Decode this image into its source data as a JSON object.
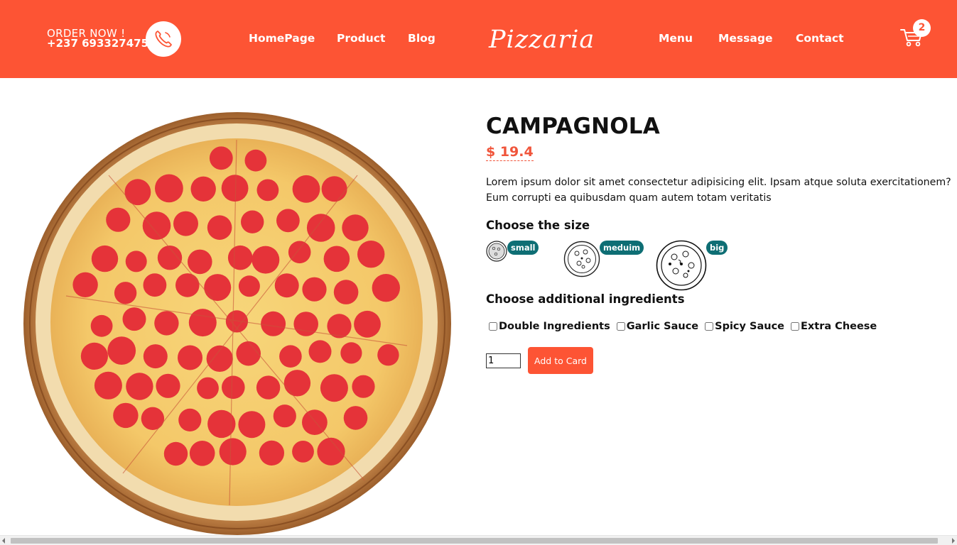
{
  "colors": {
    "accent": "#fd5434",
    "badge": "#0e6e74",
    "price": "#f0553b"
  },
  "header": {
    "order_label": "ORDER NOW !",
    "phone": "+237 693327475",
    "phone_icon": "phone-icon",
    "nav_left": [
      "HomePage",
      "Product",
      "Blog"
    ],
    "logo": "Pizzaria",
    "nav_right": [
      "Menu",
      "Message",
      "Contact"
    ],
    "cart_icon": "cart-icon",
    "cart_count": "2"
  },
  "product": {
    "title": "CAMPAGNOLA",
    "price": "$ 19.4",
    "description": "Lorem ipsum dolor sit amet consectetur adipisicing elit. Ipsam atque soluta exercitationem? Eum corrupti ea quibusdam quam autem totam veritatis",
    "size_heading": "Choose the size",
    "sizes": [
      {
        "label": "small"
      },
      {
        "label": "meduim"
      },
      {
        "label": "big"
      }
    ],
    "ingredients_heading": "Choose additional ingredients",
    "ingredients": [
      "Double Ingredients",
      "Garlic Sauce",
      "Spicy Sauce",
      "Extra Cheese"
    ],
    "quantity": "1",
    "add_button": "Add to Card"
  }
}
